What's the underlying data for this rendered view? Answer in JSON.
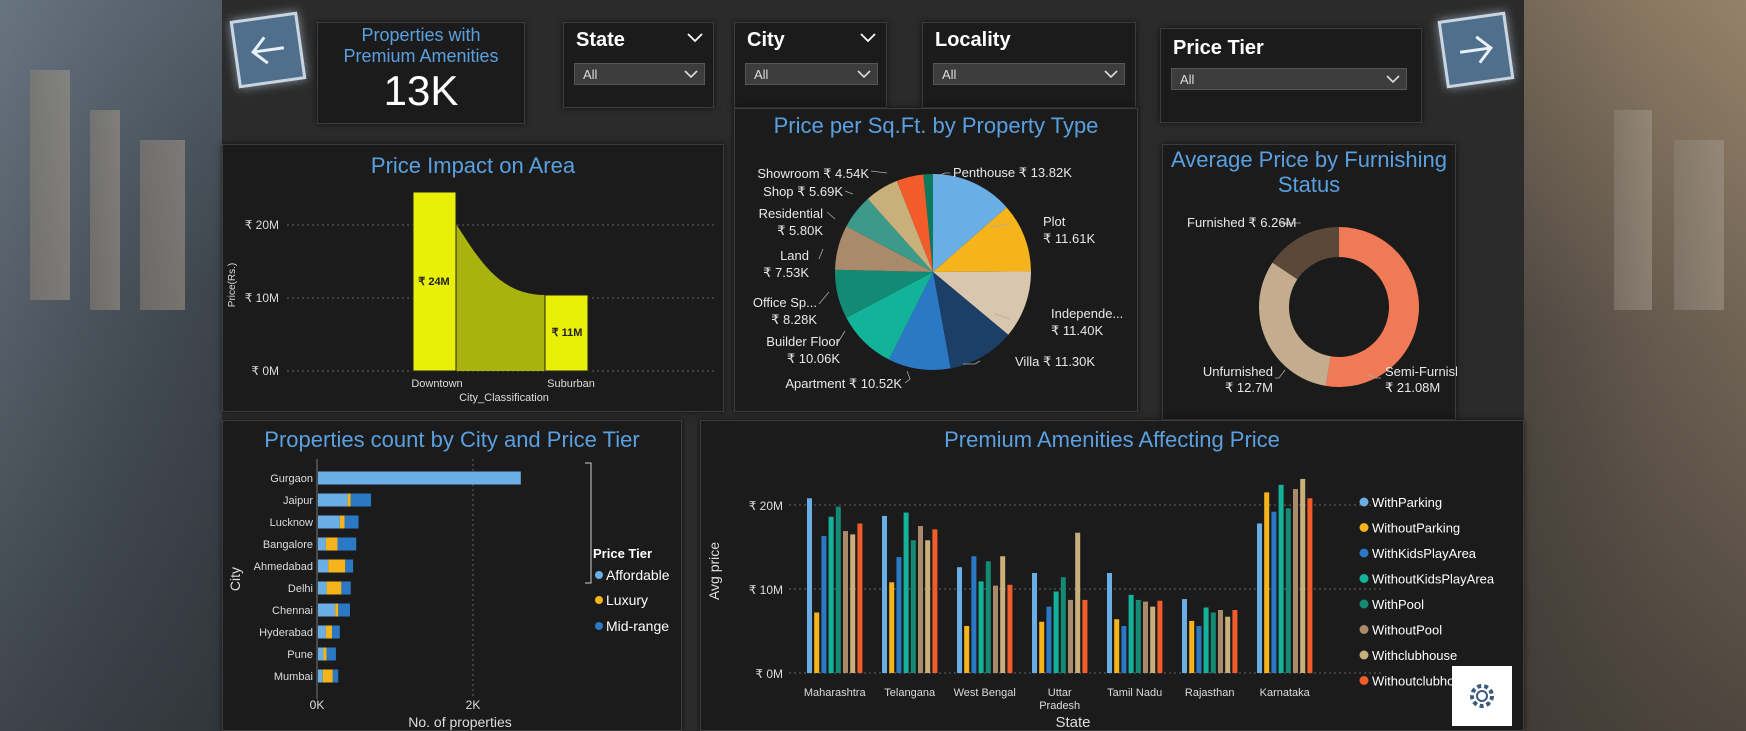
{
  "kpi": {
    "title": "Properties with Premium Amenities",
    "value": "13K"
  },
  "slicers": [
    {
      "label": "State",
      "value": "All"
    },
    {
      "label": "City",
      "value": "All"
    },
    {
      "label": "Locality",
      "value": "All"
    },
    {
      "label": "Price Tier",
      "value": "All"
    }
  ],
  "charts": {
    "area": {
      "title": "Price Impact on Area",
      "ylabel": "Price(Rs.)",
      "xlabel": "City_Classification",
      "yticks": [
        "₹ 20M",
        "₹ 10M",
        "₹ 0M"
      ],
      "categories": [
        "Downtown",
        "Suburban"
      ],
      "data_labels": [
        "₹ 24M",
        "₹ 11M"
      ]
    },
    "pie": {
      "title": "Price per Sq.Ft. by Property Type",
      "labels": [
        [
          "Penthouse ₹ 13.82K"
        ],
        [
          "Plot",
          "₹ 11.61K"
        ],
        [
          "Independe...",
          "₹ 11.40K"
        ],
        [
          "Villa ₹ 11.30K"
        ],
        [
          "Apartment ₹ 10.52K"
        ],
        [
          "Builder Floor",
          "₹ 10.06K"
        ],
        [
          "Office Sp...",
          "₹ 8.28K"
        ],
        [
          "Land",
          "₹ 7.53K"
        ],
        [
          "Residential",
          "₹ 5.80K"
        ],
        [
          "Shop ₹ 5.69K"
        ],
        [
          "Showroom ₹ 4.54K"
        ]
      ]
    },
    "donut": {
      "title_line1": "Average Price by Furnishing",
      "title_line2": "Status",
      "label_furnished": "Furnished ₹ 6.26M",
      "label_unfurnished_1": "Unfurnished",
      "label_unfurnished_2": "₹ 12.7M",
      "label_semi_1": "Semi-Furnished",
      "label_semi_2": "₹ 21.08M"
    },
    "hbar": {
      "title": "Properties count by City and Price Tier",
      "ylabel": "City",
      "xlabel": "No. of properties",
      "xticks": [
        "0K",
        "2K"
      ],
      "legend_title": "Price Tier",
      "legend": [
        "Affordable",
        "Luxury",
        "Mid-range"
      ]
    },
    "grouped": {
      "title": "Premium Amenities Affecting Price",
      "ylabel": "Avg price",
      "xlabel": "State",
      "yticks": [
        "₹ 20M",
        "₹ 10M",
        "₹ 0M"
      ],
      "legend": [
        "WithParking",
        "WithoutParking",
        "WithKidsPlayArea",
        "WithoutKidsPlayArea",
        "WithPool",
        "WithoutPool",
        "Withclubhouse",
        "Withoutclubho..."
      ]
    }
  },
  "chart_data": [
    {
      "type": "area",
      "title": "Price Impact on Area",
      "xlabel": "City_Classification",
      "ylabel": "Price(Rs.)",
      "categories": [
        "Downtown",
        "Suburban"
      ],
      "values": [
        24,
        11
      ],
      "unit": "₹ M",
      "ylim": [
        0,
        25
      ]
    },
    {
      "type": "pie",
      "title": "Price per Sq.Ft. by Property Type",
      "categories": [
        "Penthouse",
        "Plot",
        "Independe...",
        "Villa",
        "Apartment",
        "Builder Floor",
        "Office Sp...",
        "Land",
        "Residential",
        "Shop",
        "Showroom",
        "other"
      ],
      "values": [
        13.82,
        11.61,
        11.4,
        11.3,
        10.52,
        10.06,
        8.28,
        7.53,
        5.8,
        5.69,
        4.54,
        1.6
      ],
      "unit": "₹ K",
      "colors": [
        "#6aaee6",
        "#f5b31c",
        "#d8c7ae",
        "#1b3f66",
        "#2b78c4",
        "#13b39a",
        "#138a74",
        "#a98a6a",
        "#3b9a8a",
        "#c9b07a",
        "#f25c2a",
        "#0d7a5e"
      ]
    },
    {
      "type": "pie",
      "title": "Average Price by Furnishing Status",
      "categories": [
        "Semi-Furnished",
        "Unfurnished",
        "Furnished"
      ],
      "values": [
        21.08,
        12.7,
        6.26
      ],
      "unit": "₹ M",
      "colors": [
        "#f07a56",
        "#c4ad8e",
        "#5c4838"
      ]
    },
    {
      "type": "bar",
      "orientation": "horizontal",
      "stacked": true,
      "title": "Properties count by City and Price Tier",
      "xlabel": "No. of properties",
      "ylabel": "City",
      "categories": [
        "Gurgaon",
        "Jaipur",
        "Lucknow",
        "Bangalore",
        "Ahmedabad",
        "Delhi",
        "Chennai",
        "Hyderabad",
        "Pune",
        "Mumbai"
      ],
      "series": [
        {
          "name": "Affordable",
          "values": [
            2600,
            380,
            280,
            100,
            130,
            110,
            220,
            100,
            70,
            60
          ]
        },
        {
          "name": "Luxury",
          "values": [
            0,
            40,
            60,
            150,
            220,
            190,
            40,
            80,
            40,
            130
          ]
        },
        {
          "name": "Mid-range",
          "values": [
            0,
            260,
            180,
            240,
            100,
            120,
            150,
            100,
            120,
            70
          ]
        }
      ],
      "colors": [
        "#6aaee6",
        "#f5b31c",
        "#2b78c4"
      ],
      "xlim": [
        0,
        2700
      ]
    },
    {
      "type": "bar",
      "title": "Premium Amenities Affecting Price",
      "xlabel": "State",
      "ylabel": "Avg price",
      "categories": [
        "Maharashtra",
        "Telangana",
        "West Bengal",
        "Uttar Pradesh",
        "Tamil Nadu",
        "Rajasthan",
        "Karnataka"
      ],
      "series": [
        {
          "name": "WithParking",
          "values": [
            20.8,
            18.7,
            12.6,
            11.9,
            11.9,
            8.8,
            17.8
          ]
        },
        {
          "name": "WithoutParking",
          "values": [
            7.2,
            10.8,
            5.6,
            6.1,
            6.4,
            6.2,
            21.5
          ]
        },
        {
          "name": "WithKidsPlayArea",
          "values": [
            16.3,
            13.8,
            13.9,
            7.9,
            5.6,
            5.6,
            19.2
          ]
        },
        {
          "name": "WithoutKidsPlayArea",
          "values": [
            18.6,
            19.1,
            10.9,
            9.7,
            9.3,
            7.8,
            22.4
          ]
        },
        {
          "name": "WithPool",
          "values": [
            19.8,
            15.8,
            13.3,
            11.4,
            8.7,
            7.2,
            19.6
          ]
        },
        {
          "name": "WithoutPool",
          "values": [
            16.9,
            17.5,
            10.4,
            8.7,
            8.5,
            7.5,
            21.9
          ]
        },
        {
          "name": "Withclubhouse",
          "values": [
            16.5,
            15.8,
            13.9,
            16.7,
            7.9,
            6.7,
            23.1
          ]
        },
        {
          "name": "Withoutclubho...",
          "values": [
            17.8,
            17.1,
            10.5,
            8.7,
            8.6,
            7.5,
            20.8
          ]
        }
      ],
      "colors": [
        "#6aaee6",
        "#f5b31c",
        "#2b78c4",
        "#13b39a",
        "#138a74",
        "#a98a6a",
        "#c9b07a",
        "#f25c2a"
      ],
      "ylim": [
        0,
        24
      ]
    }
  ]
}
